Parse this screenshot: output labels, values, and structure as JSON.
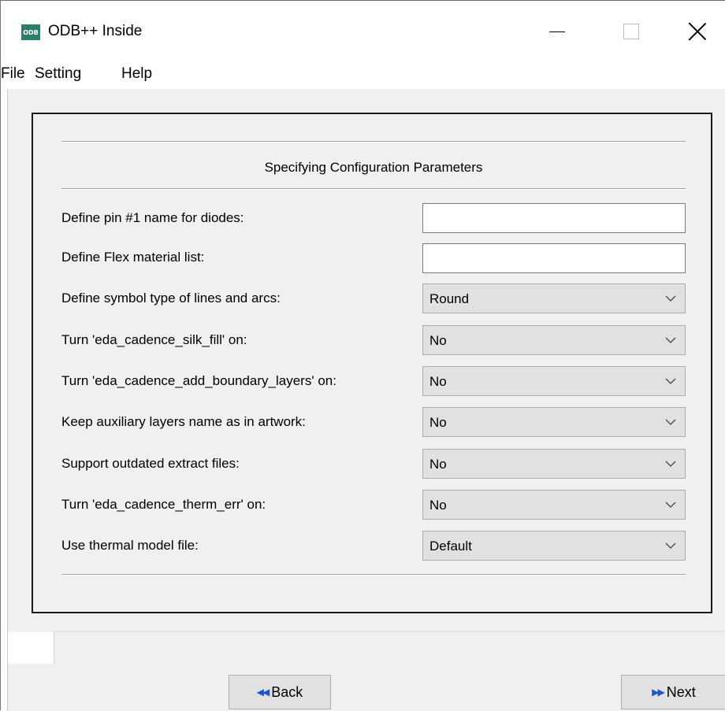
{
  "window": {
    "title": "ODB++ Inside",
    "icon_text": "ODB"
  },
  "menu": [
    "File",
    "Setting",
    "Help"
  ],
  "panel": {
    "title": "Specifying Configuration Parameters",
    "rows": [
      {
        "label": "Define pin #1 name for diodes:",
        "type": "text",
        "value": ""
      },
      {
        "label": "Define Flex material list:",
        "type": "text",
        "value": ""
      },
      {
        "label": "Define symbol type of lines and arcs:",
        "type": "select",
        "value": "Round"
      },
      {
        "label": "Turn 'eda_cadence_silk_fill' on:",
        "type": "select",
        "value": "No"
      },
      {
        "label": "Turn 'eda_cadence_add_boundary_layers' on:",
        "type": "select",
        "value": "No"
      },
      {
        "label": "Keep auxiliary layers name as in artwork:",
        "type": "select",
        "value": "No"
      },
      {
        "label": "Support outdated extract files:",
        "type": "select",
        "value": "No"
      },
      {
        "label": "Turn 'eda_cadence_therm_err' on:",
        "type": "select",
        "value": "No"
      },
      {
        "label": "Use thermal model file:",
        "type": "select",
        "value": "Default"
      }
    ]
  },
  "buttons": {
    "back": "Back",
    "next": "Next"
  }
}
